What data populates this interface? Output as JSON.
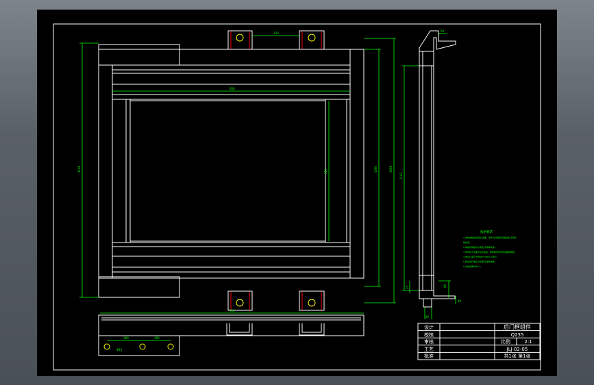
{
  "notes": {
    "title": "技术要求",
    "lines": [
      "1.零件去除氧化皮后,锐角、毛刺,允许留有切削痕迹,不得影",
      "响外观。",
      "2.焊接处焊缝均匀牢固,不得有夹渣。",
      "3.零件加工表面不应有划痕、擦伤等损伤零件表面的缺陷。",
      "4.未注公差尺寸按GB/T1804-m执行。",
      "5.焊后进行去应力处理,并涂防锈漆。",
      "6.未注倒角均为C1。"
    ]
  },
  "title_block": {
    "row_labels": [
      "设计",
      "校核",
      "审核",
      "工艺",
      "批准"
    ],
    "part_name": "后门框组件",
    "material": "Q235",
    "scale_label": "比例",
    "scale_value": "2:1",
    "drawing_no": "JLJ-02-05",
    "sheet_info": "共1张  第1张"
  },
  "dimensions": {
    "overall_height": "1196",
    "overall_width": "950",
    "inner_width": "800",
    "inner_height": "910",
    "right_h1": "1080",
    "right_h2": "1096",
    "side_height": "1163",
    "top_slot_gap": "330",
    "bottom_strip_width": "950",
    "hole_pitch_1": "180",
    "hole_pitch_2": "160",
    "hole_dia": "Φ14",
    "side_top_w": "50",
    "side_bot_a": "60",
    "side_bot_b": "40",
    "side_bot_c": "25",
    "side_bot_d": "20"
  },
  "colors": {
    "background": "#000000",
    "border": "#ffffff",
    "green": "#00ff00",
    "yellow": "#ffff00",
    "red": "#ff0000"
  }
}
